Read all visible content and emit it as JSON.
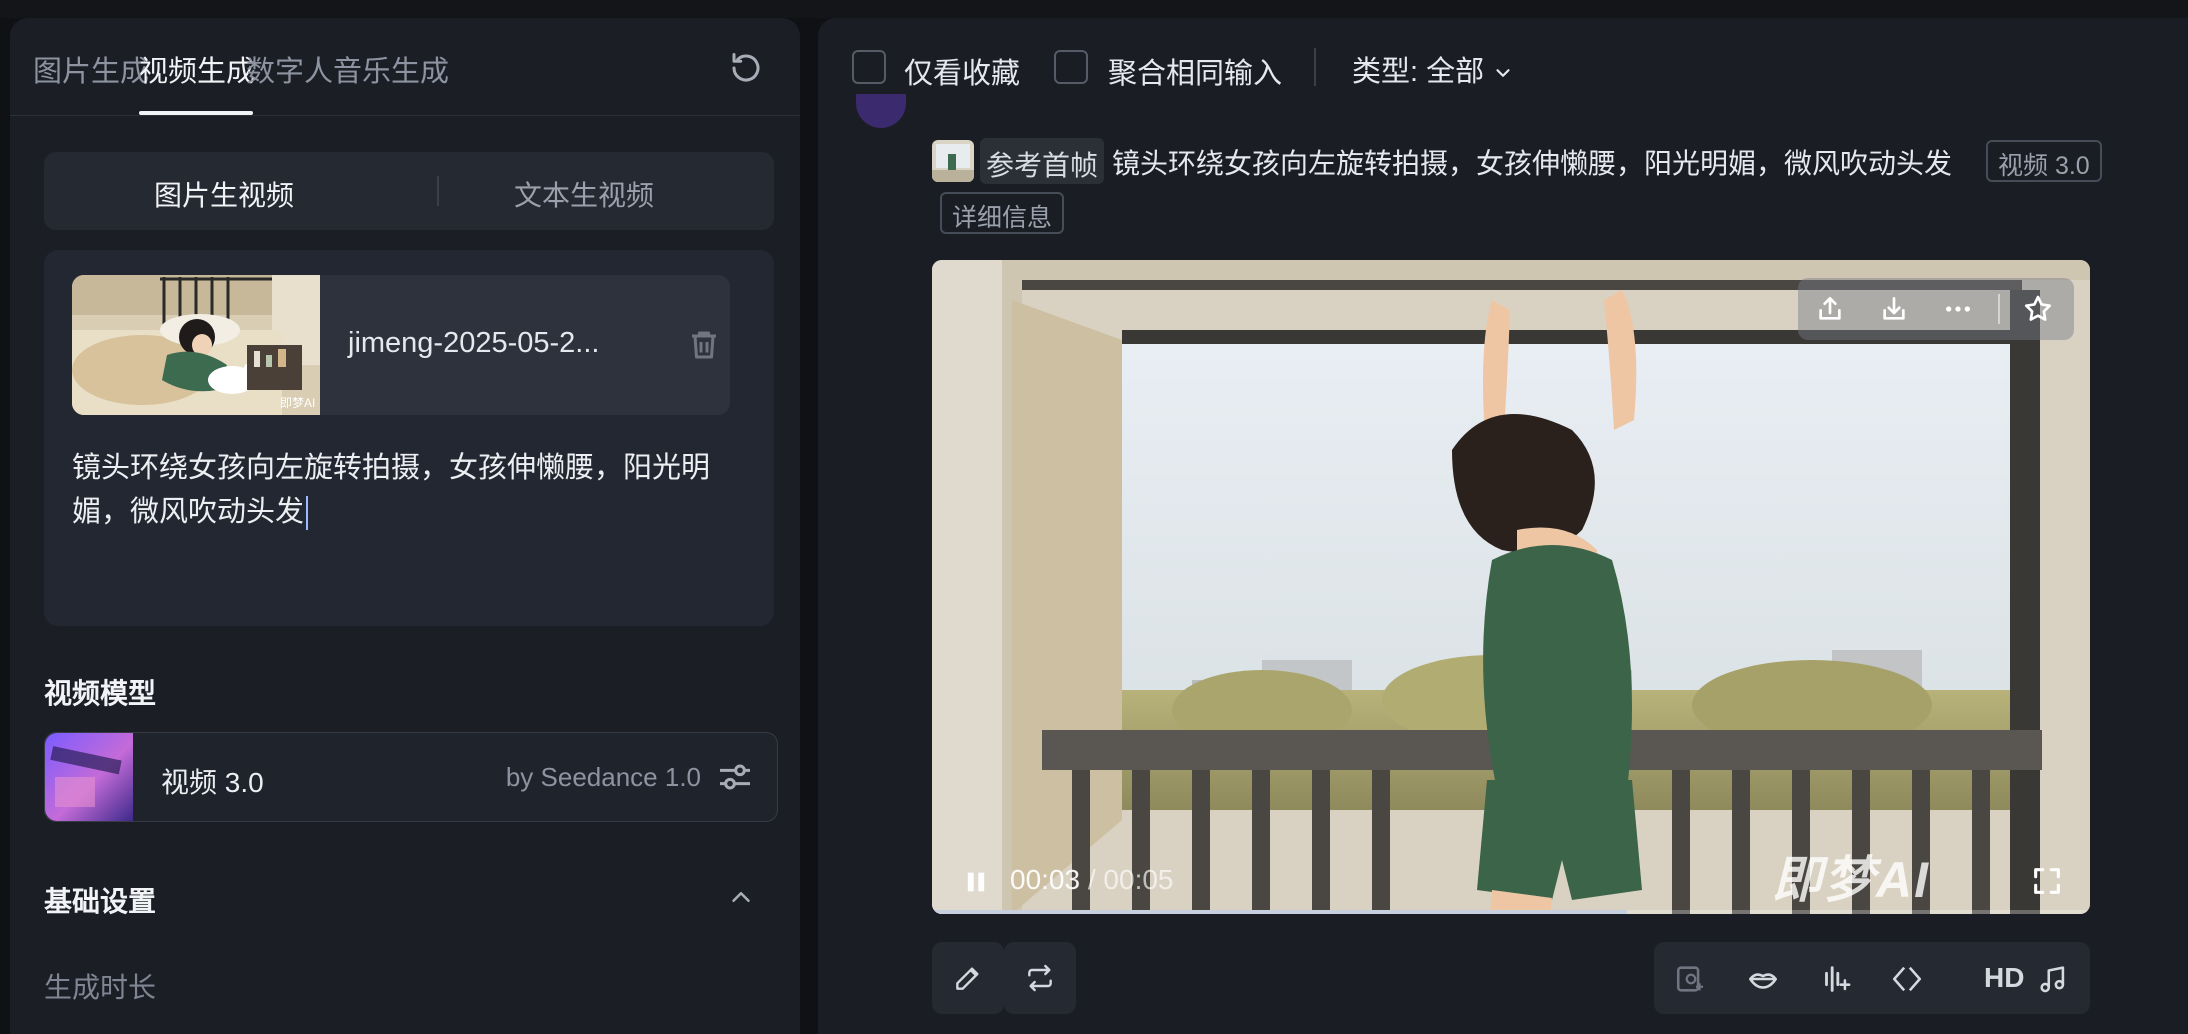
{
  "tabs": [
    {
      "label": "图片生成",
      "active": false
    },
    {
      "label": "视频生成",
      "active": true
    },
    {
      "label": "数字人",
      "active": false
    },
    {
      "label": "音乐生成",
      "active": false
    }
  ],
  "mode": {
    "options": [
      "图片生视频",
      "文本生视频"
    ],
    "selected": "图片生视频"
  },
  "upload": {
    "filename": "jimeng-2025-05-2...",
    "thumb_watermark": "即梦AI"
  },
  "prompt": {
    "value": "镜头环绕女孩向左旋转拍摄，女孩伸懒腰，阳光明媚，微风吹动头发"
  },
  "model_section": {
    "title": "视频模型",
    "model_name": "视频 3.0",
    "model_by": "by Seedance 1.0"
  },
  "basic_settings": {
    "title": "基础设置",
    "duration_label": "生成时长"
  },
  "filters": {
    "favorites_label": "仅看收藏",
    "merge_label": "聚合相同输入",
    "type_label": "类型: 全部"
  },
  "record": {
    "ref_label": "参考首帧",
    "prompt": "镜头环绕女孩向左旋转拍摄，女孩伸懒腰，阳光明媚，微风吹动头发",
    "model_tag": "视频 3.0",
    "details_tag": "详细信息"
  },
  "player": {
    "current_time": "00:03",
    "separator": " / ",
    "total_time": "00:05",
    "progress": 0.6,
    "watermark": "即梦AI"
  },
  "toolbar": {
    "hd_label": "HD"
  },
  "colors": {
    "panel": "#1b1e25",
    "background": "#0f1115",
    "accent_text": "#f2f3f6",
    "muted_text": "#8d93a0"
  }
}
